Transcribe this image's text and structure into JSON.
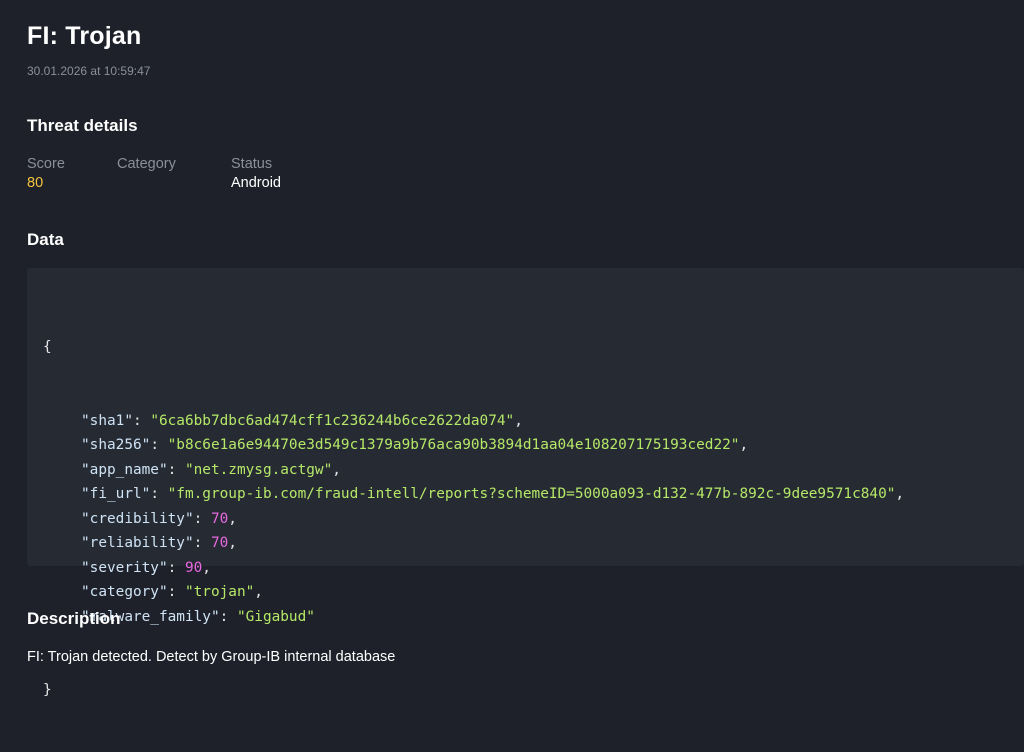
{
  "header": {
    "title": "FI: Trojan",
    "timestamp": "30.01.2026 at 10:59:47"
  },
  "threat_details": {
    "heading": "Threat details",
    "fields": [
      {
        "label": "Score",
        "value": "80",
        "value_color": "#f2c53d"
      },
      {
        "label": "Category",
        "value": ""
      },
      {
        "label": "Status",
        "value": "Android"
      }
    ]
  },
  "data_section": {
    "heading": "Data",
    "open_brace": "{",
    "close_brace": "}",
    "entries": [
      {
        "key": "\"sha1\"",
        "value": "\"6ca6bb7dbc6ad474cff1c236244b6ce2622da074\"",
        "type": "string",
        "sep": ","
      },
      {
        "key": "\"sha256\"",
        "value": "\"b8c6e1a6e94470e3d549c1379a9b76aca90b3894d1aa04e108207175193ced22\"",
        "type": "string",
        "sep": ","
      },
      {
        "key": "\"app_name\"",
        "value": "\"net.zmysg.actgw\"",
        "type": "string",
        "sep": ","
      },
      {
        "key": "\"fi_url\"",
        "value": "\"fm.group-ib.com/fraud-intell/reports?schemeID=5000a093-d132-477b-892c-9dee9571c840\"",
        "type": "string",
        "sep": ","
      },
      {
        "key": "\"credibility\"",
        "value": "70",
        "type": "number",
        "sep": ","
      },
      {
        "key": "\"reliability\"",
        "value": "70",
        "type": "number",
        "sep": ","
      },
      {
        "key": "\"severity\"",
        "value": "90",
        "type": "number",
        "sep": ","
      },
      {
        "key": "\"category\"",
        "value": "\"trojan\"",
        "type": "string",
        "sep": ","
      },
      {
        "key": "\"malware_family\"",
        "value": "\"Gigabud\"",
        "type": "string",
        "sep": ""
      }
    ],
    "colors": {
      "key": "#cfe3f5",
      "string": "#b5e868",
      "number": "#e868e0"
    }
  },
  "description": {
    "heading": "Description",
    "text": "FI: Trojan detected. Detect by Group-IB internal database"
  }
}
